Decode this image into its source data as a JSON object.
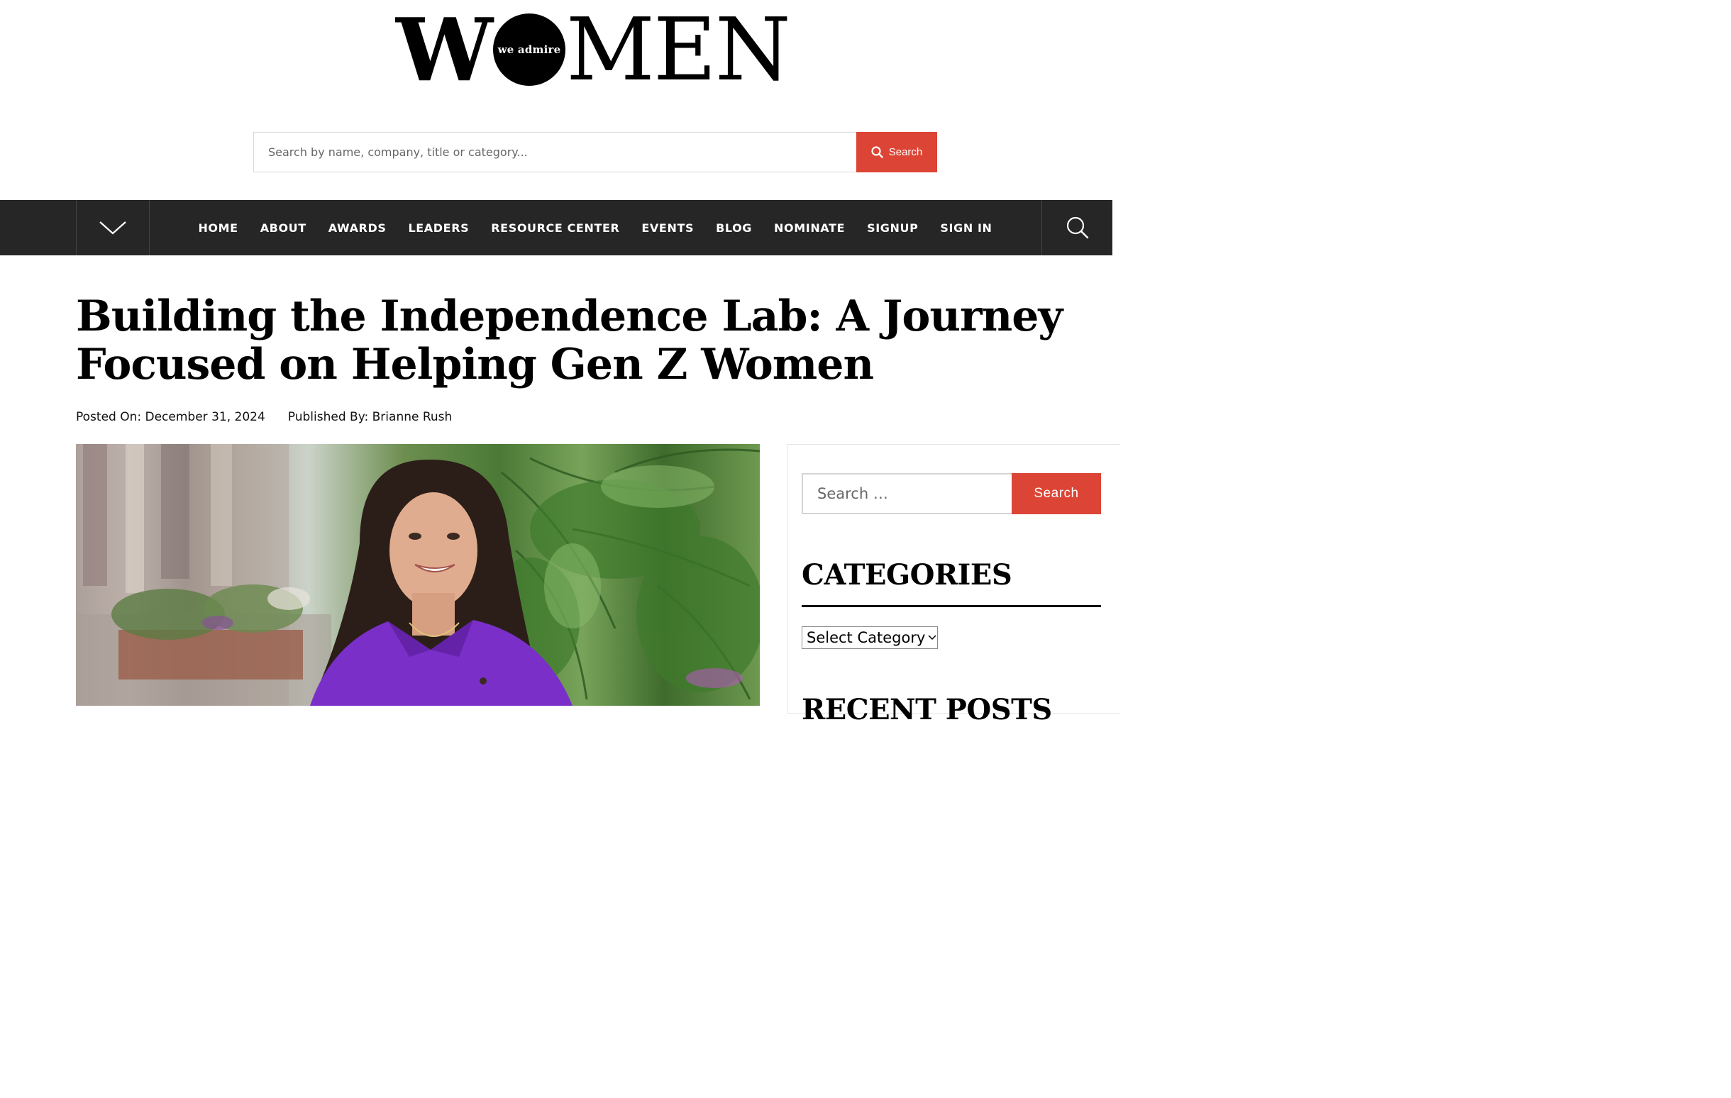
{
  "logo": {
    "w": "W",
    "circle_text": "we admire",
    "men": "MEN"
  },
  "top_search": {
    "placeholder": "Search by name, company, title or category...",
    "button_label": "Search"
  },
  "nav": {
    "items": [
      "HOME",
      "ABOUT",
      "AWARDS",
      "LEADERS",
      "RESOURCE CENTER",
      "EVENTS",
      "BLOG",
      "NOMINATE",
      "SIGNUP",
      "SIGN IN"
    ]
  },
  "article": {
    "title": "Building the Independence Lab: A Journey Focused on Helping Gen Z Women",
    "posted_on": "Posted On: December 31, 2024",
    "published_by": "Published By: Brianne Rush"
  },
  "sidebar": {
    "search_placeholder": "Search …",
    "search_button": "Search",
    "categories_heading": "CATEGORIES",
    "category_select": "Select Category",
    "recent_posts_heading": "RECENT POSTS"
  },
  "colors": {
    "accent": "#dc4535",
    "nav_bg": "#262626",
    "shirt": "#7a2fc8"
  }
}
